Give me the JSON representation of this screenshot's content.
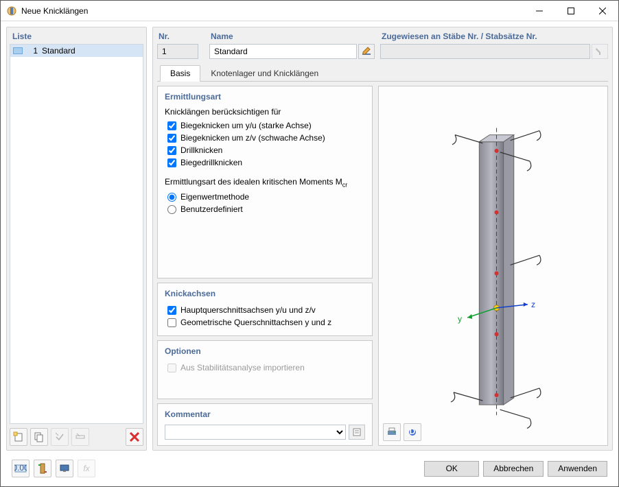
{
  "window": {
    "title": "Neue Knicklängen"
  },
  "list": {
    "header": "Liste",
    "items": [
      {
        "num": "1",
        "label": "Standard"
      }
    ]
  },
  "fields": {
    "nr": {
      "label": "Nr.",
      "value": "1"
    },
    "name": {
      "label": "Name",
      "value": "Standard"
    },
    "assigned": {
      "label": "Zugewiesen an Stäbe Nr. / Stabsätze Nr.",
      "value": ""
    }
  },
  "tabs": {
    "basis": "Basis",
    "nodal": "Knotenlager und Knicklängen"
  },
  "ermittlung": {
    "title": "Ermittlungsart",
    "subhead": "Knicklängen berücksichtigen für",
    "chk_yu": "Biegeknicken um y/u (starke Achse)",
    "chk_zv": "Biegeknicken um z/v (schwache Achse)",
    "chk_drill": "Drillknicken",
    "chk_biegedrill": "Biegedrillknicken",
    "mcr_head": "Ermittlungsart des idealen kritischen Moments M",
    "mcr_sub": "cr",
    "rad_eigen": "Eigenwertmethode",
    "rad_user": "Benutzerdefiniert"
  },
  "knickachsen": {
    "title": "Knickachsen",
    "chk_haupt": "Hauptquerschnittsachsen y/u und z/v",
    "chk_geom": "Geometrische Querschnittachsen y und z"
  },
  "optionen": {
    "title": "Optionen",
    "chk_import": "Aus Stabilitätsanalyse importieren"
  },
  "kommentar": {
    "title": "Kommentar"
  },
  "preview": {
    "axis_y": "y",
    "axis_z": "z"
  },
  "buttons": {
    "ok": "OK",
    "cancel": "Abbrechen",
    "apply": "Anwenden"
  },
  "icons": {
    "new": "new-icon",
    "copy": "copy-icon",
    "delete": "delete-icon"
  }
}
